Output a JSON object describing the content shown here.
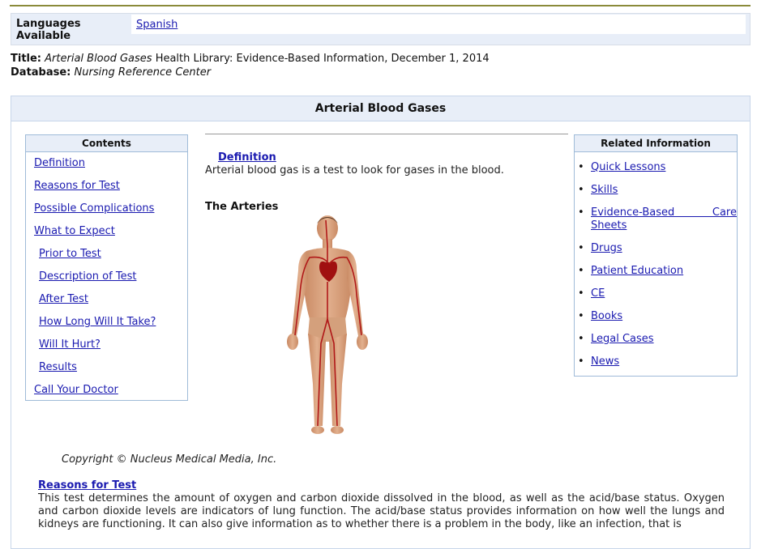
{
  "languages": {
    "label": "Languages Available",
    "value": "Spanish"
  },
  "meta": {
    "title_label": "Title:",
    "title_italic": "Arterial Blood Gases",
    "title_rest": " Health Library: Evidence-Based Information, December 1, 2014",
    "database_label": "Database:",
    "database_value": "Nursing Reference Center"
  },
  "article": {
    "heading": "Arterial Blood Gases",
    "definition_heading": "Definition",
    "definition_text": "Arterial blood gas is a test to look for gases in the blood.",
    "image_title": "The Arteries",
    "copyright": "Copyright © Nucleus Medical Media, Inc.",
    "reasons_heading": "Reasons for Test",
    "reasons_text": "This test determines the amount of oxygen and carbon dioxide dissolved in the blood, as well as the acid/base status. Oxygen and carbon dioxide levels are indicators of lung function. The acid/base status provides information on how well the lungs and kidneys are functioning. It can also give information as to whether there is a problem in the body, like an infection, that is"
  },
  "contents": {
    "title": "Contents",
    "items": [
      "Definition",
      "Reasons for Test",
      "Possible Complications",
      "What to Expect",
      "Prior to Test",
      "Description of Test",
      "After Test",
      "How Long Will It Take?",
      "Will It Hurt?",
      "Results",
      "Call Your Doctor"
    ]
  },
  "related": {
    "title": "Related Information",
    "items": [
      "Quick Lessons",
      "Skills",
      "Evidence-Based Care Sheets",
      "Drugs",
      "Patient Education",
      "CE",
      "Books",
      "Legal Cases",
      "News"
    ]
  },
  "colors": {
    "link": "#1a1ab0",
    "header_bg": "#e8eef8",
    "border": "#9fbbd8",
    "artery_red": "#b01818",
    "skin": "#d9a37e"
  }
}
